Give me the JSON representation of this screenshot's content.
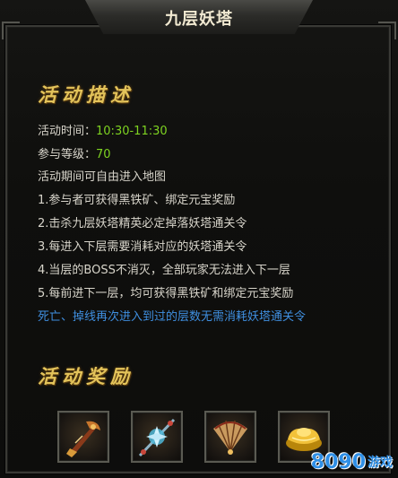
{
  "title": "九层妖塔",
  "description": {
    "heading": "活动描述",
    "time_label": "活动时间：",
    "time_value": "10:30-11:30",
    "level_label": "参与等级：",
    "level_value": "70",
    "free_entry": "活动期间可自由进入地图",
    "rules": [
      "1.参与者可获得黑铁矿、绑定元宝奖励",
      "2.击杀九层妖塔精英必定掉落妖塔通关令",
      "3.每进入下层需要消耗对应的妖塔通关令",
      "4.当层的BOSS不消灭，全部玩家无法进入下一层",
      "5.每前进下一层，均可获得黑铁矿和绑定元宝奖励"
    ],
    "note": "死亡、掉线再次进入到过的层数无需消耗妖塔通关令"
  },
  "rewards": {
    "heading": "活动奖励",
    "items": [
      {
        "icon": "weapon-icon"
      },
      {
        "icon": "crystal-spear-icon"
      },
      {
        "icon": "fan-icon"
      },
      {
        "icon": "gold-ingot-icon"
      }
    ]
  },
  "watermark": {
    "number": "8090",
    "text": "游戏"
  },
  "colors": {
    "heading": "#e3c35a",
    "text": "#d8d5cb",
    "value_green": "#7ed321",
    "note_blue": "#3f8fe0",
    "watermark_blue": "#2f8fe6"
  }
}
